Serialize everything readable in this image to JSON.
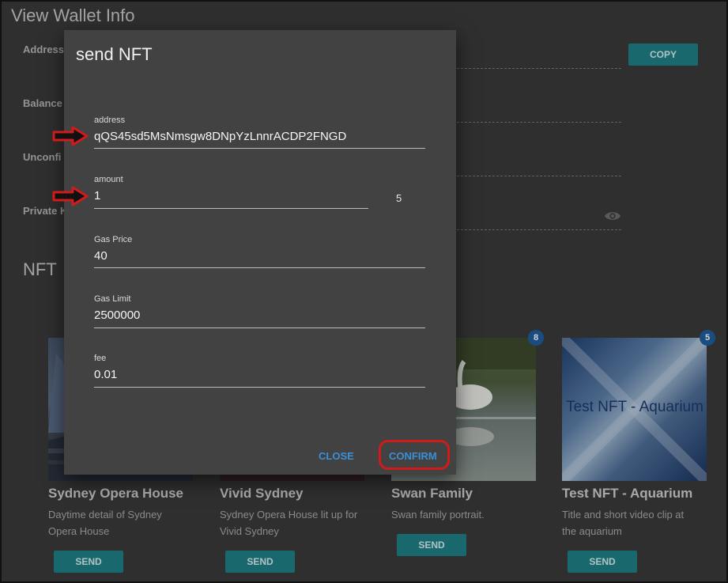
{
  "page": {
    "title": "View Wallet Info",
    "fields": {
      "address_label": "Address",
      "balance_label": "Balance",
      "unconfirmed_label": "Unconfi",
      "private_key_label": "Private K"
    },
    "copy_label": "COPY",
    "nft_section_title": "NFT"
  },
  "nfts": [
    {
      "title": "Sydney Opera House",
      "desc_line1": "Daytime detail of Sydney",
      "desc_line2": "Opera House",
      "send_label": "SEND"
    },
    {
      "title": "Vivid Sydney",
      "desc_line1": "Sydney Opera House lit up for",
      "desc_line2": "Vivid Sydney",
      "send_label": "SEND"
    },
    {
      "title": "Swan Family",
      "desc_line1": "Swan family portrait.",
      "desc_line2": "",
      "send_label": "SEND",
      "count": "8"
    },
    {
      "title": "Test NFT - Aquarium",
      "desc_line1": "Title and short video clip at",
      "desc_line2": "the aquarium",
      "send_label": "SEND",
      "count": "5",
      "image_text": "Test NFT - Aquarium"
    }
  ],
  "dialog": {
    "title": "send NFT",
    "address": {
      "label": "address",
      "value": "qQS45sd5MsNmsgw8DNpYzLnnrACDP2FNGD"
    },
    "amount": {
      "label": "amount",
      "value": "1",
      "suffix": "5"
    },
    "gas_price": {
      "label": "Gas Price",
      "value": "40"
    },
    "gas_limit": {
      "label": "Gas Limit",
      "value": "2500000"
    },
    "fee": {
      "label": "fee",
      "value": "0.01"
    },
    "close_label": "CLOSE",
    "confirm_label": "CONFIRM"
  },
  "colors": {
    "accent_teal": "#1f7f86",
    "link_blue": "#3a8fd6",
    "highlight_red": "#d11b1b",
    "badge_blue": "#1f5f9e"
  }
}
